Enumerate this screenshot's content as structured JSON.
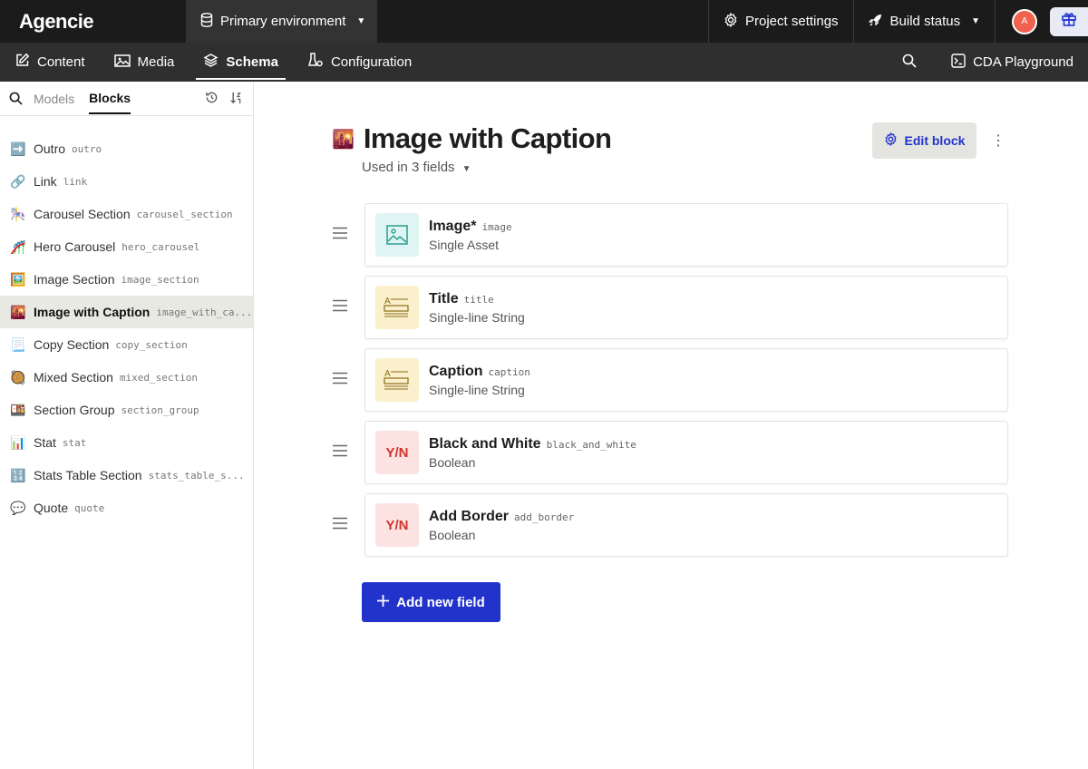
{
  "topbar": {
    "brand": "Agencie",
    "environment": "Primary environment",
    "project_settings": "Project settings",
    "build_status": "Build status",
    "avatar_initial": "A"
  },
  "nav": {
    "content": "Content",
    "media": "Media",
    "schema": "Schema",
    "configuration": "Configuration",
    "cda_playground": "CDA Playground"
  },
  "sidebar": {
    "tab_models": "Models",
    "tab_blocks": "Blocks",
    "items": [
      {
        "emoji": "➡️",
        "label": "Outro",
        "code": "outro"
      },
      {
        "emoji": "🔗",
        "label": "Link",
        "code": "link"
      },
      {
        "emoji": "🎠",
        "label": "Carousel Section",
        "code": "carousel_section"
      },
      {
        "emoji": "🎢",
        "label": "Hero Carousel",
        "code": "hero_carousel"
      },
      {
        "emoji": "🖼️",
        "label": "Image Section",
        "code": "image_section"
      },
      {
        "emoji": "🌇",
        "label": "Image with Caption",
        "code": "image_with_ca..."
      },
      {
        "emoji": "📃",
        "label": "Copy Section",
        "code": "copy_section"
      },
      {
        "emoji": "🥘",
        "label": "Mixed Section",
        "code": "mixed_section"
      },
      {
        "emoji": "🍱",
        "label": "Section Group",
        "code": "section_group"
      },
      {
        "emoji": "📊",
        "label": "Stat",
        "code": "stat"
      },
      {
        "emoji": "🔢",
        "label": "Stats Table Section",
        "code": "stats_table_s..."
      },
      {
        "emoji": "💬",
        "label": "Quote",
        "code": "quote"
      }
    ]
  },
  "main": {
    "emoji": "🌇",
    "title": "Image with Caption",
    "used_in": "Used in 3 fields",
    "edit_block": "Edit block",
    "add_field": "Add new field",
    "fields": [
      {
        "name": "Image*",
        "code": "image",
        "type": "Single Asset",
        "icon": "image"
      },
      {
        "name": "Title",
        "code": "title",
        "type": "Single-line String",
        "icon": "string"
      },
      {
        "name": "Caption",
        "code": "caption",
        "type": "Single-line String",
        "icon": "string"
      },
      {
        "name": "Black and White",
        "code": "black_and_white",
        "type": "Boolean",
        "icon": "bool",
        "icon_text": "Y/N"
      },
      {
        "name": "Add Border",
        "code": "add_border",
        "type": "Boolean",
        "icon": "bool",
        "icon_text": "Y/N"
      }
    ]
  },
  "colors": {
    "primary": "#2233cc",
    "topbar": "#1b1b1b",
    "navbar": "#2f2f2f",
    "avatar": "#f0624d"
  }
}
